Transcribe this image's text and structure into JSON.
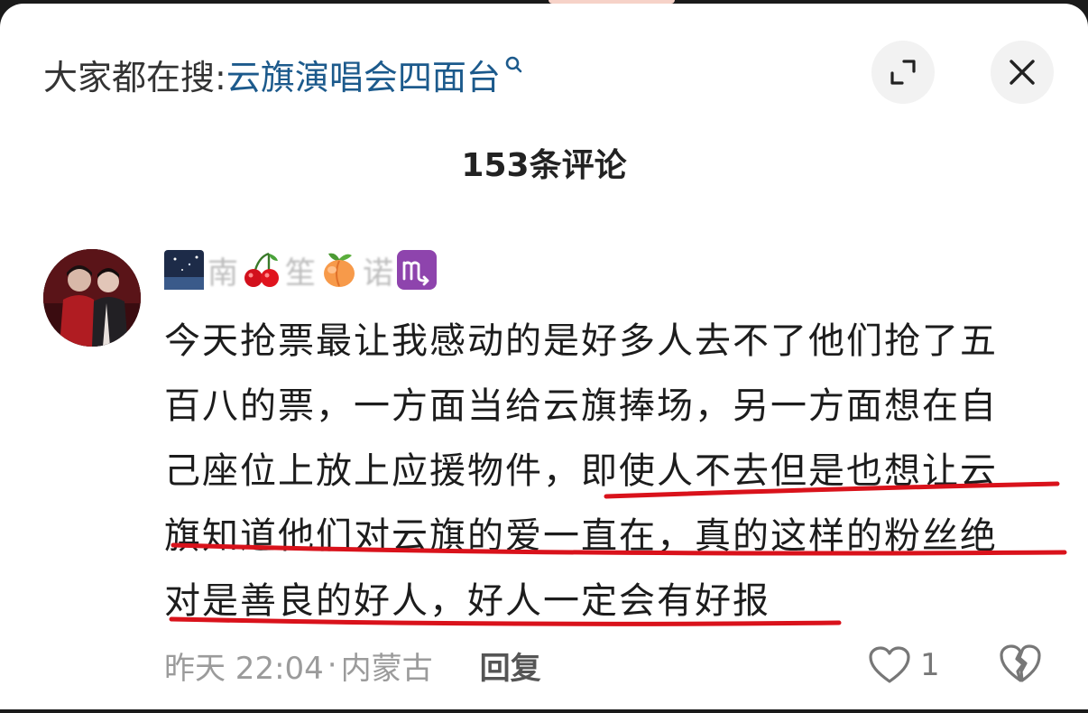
{
  "search": {
    "prefix": "大家都在搜:",
    "term": "云旗演唱会四面台"
  },
  "header": {
    "comment_count": "153条评论"
  },
  "comment": {
    "username_chars": [
      "南",
      "笙",
      "诺"
    ],
    "lines": [
      "今天抢票最让我感动的是好多人去不了他们抢了五",
      "百八的票，一方面当给云旗捧场，另一方面想在自",
      "己座位上放上应援物件，即使人不去但是也想让云",
      "旗知道他们对云旗的爱一直在，真的这样的粉丝绝",
      "对是善良的好人，好人一定会有好报"
    ],
    "time": "昨天 22:04",
    "dot": "·",
    "location": "内蒙古",
    "reply_label": "回复",
    "like_count": "1"
  },
  "colors": {
    "search_term": "#1c5a8c",
    "underline": "#d9121b"
  },
  "icons": [
    "search-icon",
    "expand-icon",
    "close-icon",
    "heart-icon",
    "broken-heart-icon",
    "cherry-emoji",
    "peach-emoji",
    "scorpio-emoji"
  ]
}
